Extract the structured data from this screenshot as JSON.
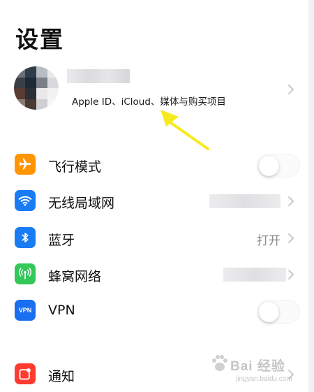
{
  "header": {
    "title": "设置"
  },
  "profile": {
    "subtitle": "Apple ID、iCloud、媒体与购买项目"
  },
  "rows": [
    {
      "label": "飞行模式",
      "icon": "airplane-icon",
      "color": "#ff9500",
      "accessory": "toggle",
      "on": false
    },
    {
      "label": "无线局域网",
      "icon": "wifi-icon",
      "color": "#1a7cf5",
      "accessory": "chevron"
    },
    {
      "label": "蓝牙",
      "icon": "bluetooth-icon",
      "color": "#1a7cf5",
      "value": "打开",
      "accessory": "chevron"
    },
    {
      "label": "蜂窝网络",
      "icon": "cellular-icon",
      "color": "#34c759",
      "accessory": "chevron"
    },
    {
      "label": "VPN",
      "icon": "vpn-icon",
      "icon_text": "VPN",
      "color": "#1a6ef0",
      "accessory": "toggle",
      "on": false
    },
    {
      "label": "通知",
      "icon": "notification-icon",
      "color": "#ff3b30",
      "accessory": "chevron"
    }
  ],
  "watermark": {
    "main": "Bai 经验",
    "sub": "jingyan.baidu.com"
  }
}
